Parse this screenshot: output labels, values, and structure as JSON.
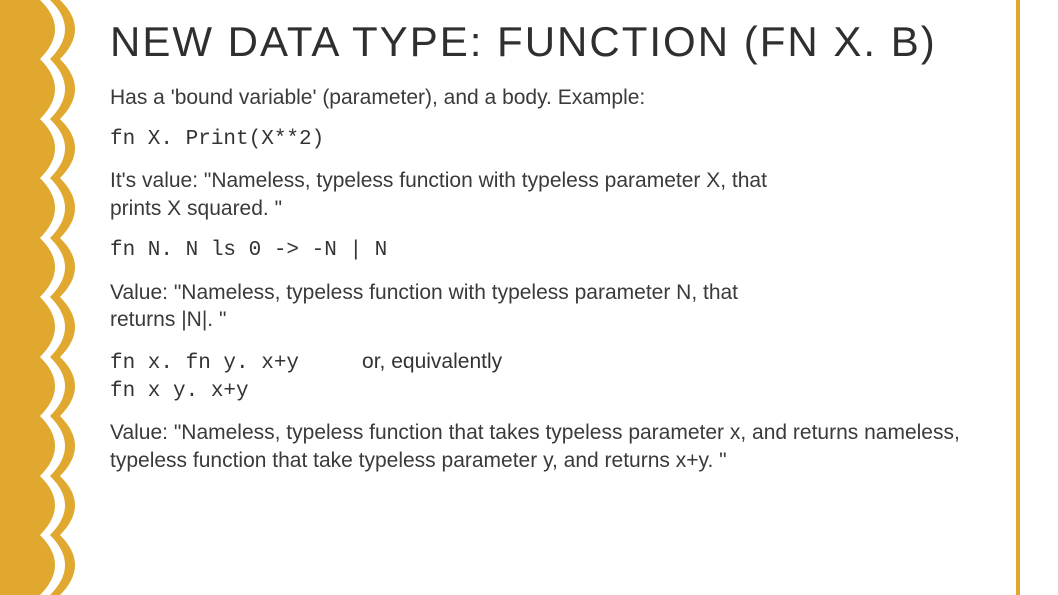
{
  "title": "NEW DATA TYPE: FUNCTION (FN X. B)",
  "intro": "Has a 'bound variable' (parameter), and a body. Example:",
  "code1": "fn X. Print(X**2)",
  "value1": "It's value: \"Nameless, typeless function with typeless parameter X, that prints X squared. \"",
  "code2": "fn N. N ls 0 -> -N | N",
  "value2": "Value: \"Nameless, typeless function with typeless  parameter N, that returns |N|. \"",
  "code3a": "fn x. fn y. x+y",
  "eq_note": "or, equivalently",
  "code3b": "fn x y. x+y",
  "value3": "Value: \"Nameless, typeless function that takes typeless parameter x, and returns nameless, typeless function that take typeless parameter y, and returns x+y. \"",
  "colors": {
    "accent": "#e0a82e",
    "text": "#333333"
  }
}
